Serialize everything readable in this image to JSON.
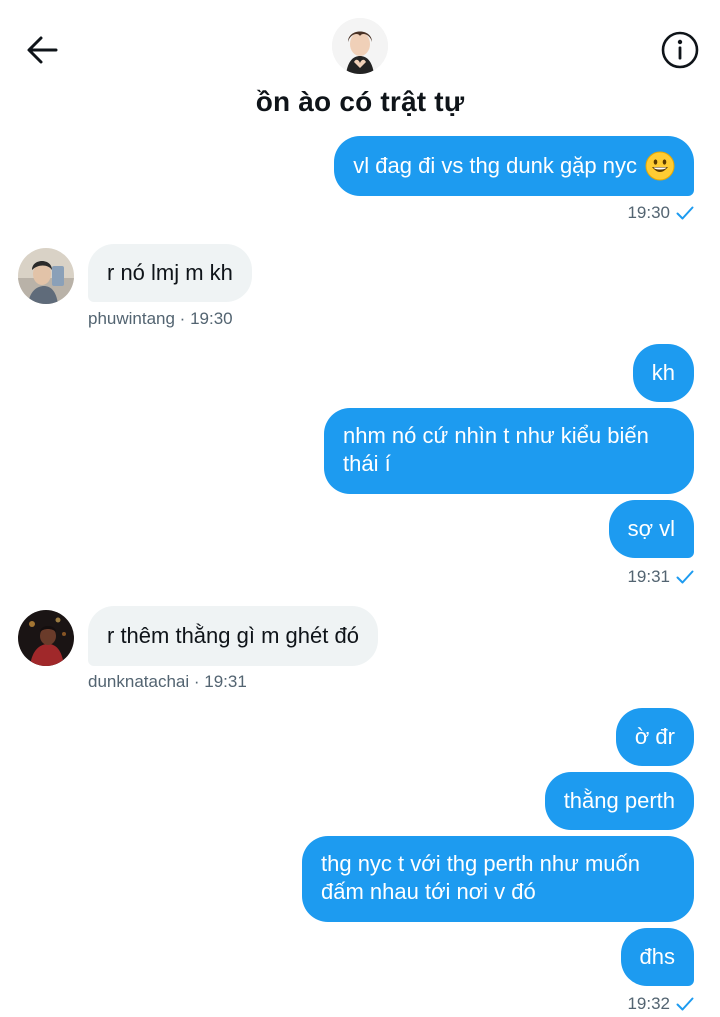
{
  "header": {
    "title": "ồn ào có trật tự",
    "back_icon": "arrow-left-icon",
    "info_icon": "info-circle-icon"
  },
  "colors": {
    "accent": "#1d9bf0",
    "incoming_bubble": "#eff3f4",
    "meta_text": "#536471"
  },
  "messages": {
    "m1": {
      "text": "vl đag đi vs thg dunk gặp nyc",
      "emoji": "grinning-face-icon"
    },
    "m1_meta": {
      "time": "19:30"
    },
    "m2": {
      "text": "r nó lmj m kh"
    },
    "m2_meta": {
      "sender_time": "phuwintang · 19:30"
    },
    "m3": {
      "text": "kh"
    },
    "m4": {
      "text": "nhm nó cứ nhìn t như kiểu biến thái í"
    },
    "m5": {
      "text": "sợ vl"
    },
    "m5_meta": {
      "time": "19:31"
    },
    "m6": {
      "text": "r thêm thằng gì m ghét đó"
    },
    "m6_meta": {
      "sender_time": "dunknatachai · 19:31"
    },
    "m7": {
      "text": "ờ đr"
    },
    "m8": {
      "text": "thằng perth"
    },
    "m9": {
      "text": "thg nyc t với thg perth như muốn đấm nhau tới nơi v đó"
    },
    "m10": {
      "text": "đhs"
    },
    "m10_meta": {
      "time": "19:32"
    }
  }
}
